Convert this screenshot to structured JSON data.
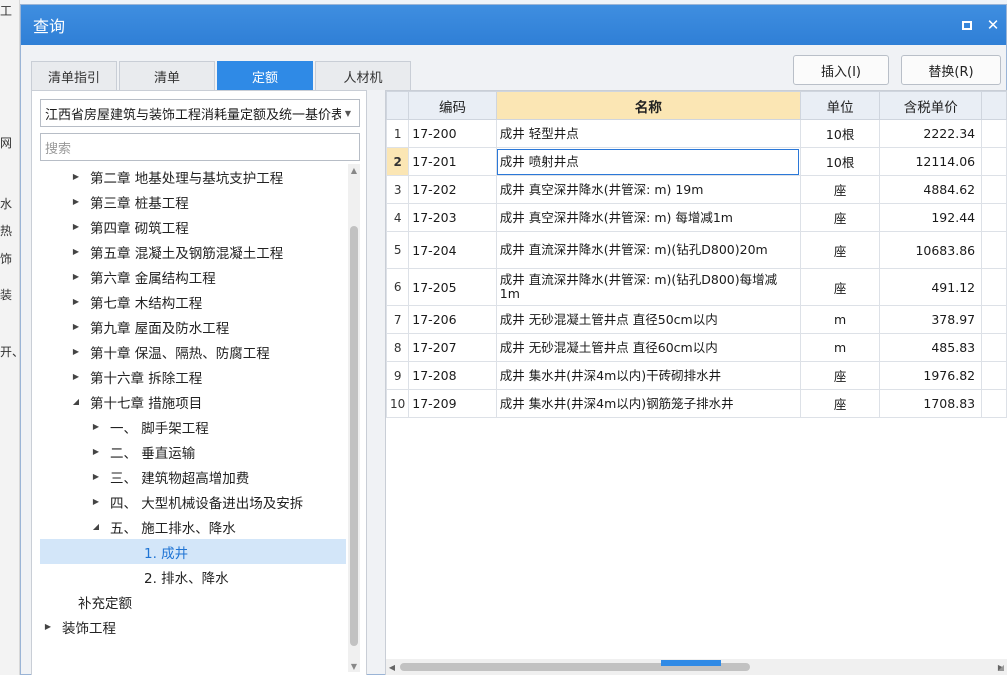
{
  "background": {
    "frags": [
      "工",
      "网",
      "水",
      "热",
      "饰",
      "装",
      "开、"
    ]
  },
  "dialog": {
    "title": "查询",
    "maximize_label": "",
    "close_label": "✕"
  },
  "tabs": [
    "清单指引",
    "清单",
    "定额",
    "人材机"
  ],
  "active_tab": 2,
  "buttons": {
    "insert": "插入(I)",
    "replace": "替换(R)"
  },
  "left_panel": {
    "library": "江西省房屋建筑与装饰工程消耗量定额及统一基价表",
    "search_placeholder": "搜索",
    "tree": [
      {
        "label": "第二章 地基处理与基坑支护工程",
        "level": 1,
        "expander": "collapsed"
      },
      {
        "label": "第三章 桩基工程",
        "level": 1,
        "expander": "collapsed"
      },
      {
        "label": "第四章 砌筑工程",
        "level": 1,
        "expander": "collapsed"
      },
      {
        "label": "第五章 混凝土及钢筋混凝土工程",
        "level": 1,
        "expander": "collapsed"
      },
      {
        "label": "第六章 金属结构工程",
        "level": 1,
        "expander": "collapsed"
      },
      {
        "label": "第七章 木结构工程",
        "level": 1,
        "expander": "collapsed"
      },
      {
        "label": "第九章 屋面及防水工程",
        "level": 1,
        "expander": "collapsed"
      },
      {
        "label": "第十章 保温、隔热、防腐工程",
        "level": 1,
        "expander": "collapsed"
      },
      {
        "label": "第十六章 拆除工程",
        "level": 1,
        "expander": "collapsed"
      },
      {
        "label": "第十七章 措施项目",
        "level": 1,
        "expander": "expanded"
      },
      {
        "label": "一、 脚手架工程",
        "level": 2,
        "expander": "collapsed"
      },
      {
        "label": "二、 垂直运输",
        "level": 2,
        "expander": "collapsed"
      },
      {
        "label": "三、 建筑物超高增加费",
        "level": 2,
        "expander": "collapsed"
      },
      {
        "label": "四、 大型机械设备进出场及安拆",
        "level": 2,
        "expander": "collapsed"
      },
      {
        "label": "五、 施工排水、降水",
        "level": 2,
        "expander": "expanded"
      },
      {
        "label": "1. 成井",
        "level": 3,
        "expander": "none",
        "selected": true
      },
      {
        "label": "2. 排水、降水",
        "level": 3,
        "expander": "none"
      },
      {
        "label": "补充定额",
        "level": 1,
        "expander": "none"
      },
      {
        "label": "装饰工程",
        "level": 0,
        "expander": "collapsed"
      }
    ]
  },
  "table": {
    "columns": [
      "编码",
      "名称",
      "单位",
      "含税单价"
    ],
    "rows": [
      {
        "no": "1",
        "code": "17-200",
        "name": "成井 轻型井点",
        "unit": "10根",
        "price": "2222.34"
      },
      {
        "no": "2",
        "code": "17-201",
        "name": "成井 喷射井点",
        "unit": "10根",
        "price": "12114.06"
      },
      {
        "no": "3",
        "code": "17-202",
        "name": "成井 真空深井降水(井管深: m) 19m",
        "unit": "座",
        "price": "4884.62"
      },
      {
        "no": "4",
        "code": "17-203",
        "name": "成井 真空深井降水(井管深: m) 每增减1m",
        "unit": "座",
        "price": "192.44"
      },
      {
        "no": "5",
        "code": "17-204",
        "name": "成井 直流深井降水(井管深: m)(钻孔D800)20m",
        "unit": "座",
        "price": "10683.86"
      },
      {
        "no": "6",
        "code": "17-205",
        "name": "成井 直流深井降水(井管深: m)(钻孔D800)每增减1m",
        "unit": "座",
        "price": "491.12"
      },
      {
        "no": "7",
        "code": "17-206",
        "name": "成井 无砂混凝土管井点 直径50cm以内",
        "unit": "m",
        "price": "378.97"
      },
      {
        "no": "8",
        "code": "17-207",
        "name": "成井 无砂混凝土管井点 直径60cm以内",
        "unit": "m",
        "price": "485.83"
      },
      {
        "no": "9",
        "code": "17-208",
        "name": "成井 集水井(井深4m以内)干砖砌排水井",
        "unit": "座",
        "price": "1976.82"
      },
      {
        "no": "10",
        "code": "17-209",
        "name": "成井 集水井(井深4m以内)钢筋笼子排水井",
        "unit": "座",
        "price": "1708.83"
      }
    ],
    "current_row": 1
  },
  "colors": {
    "accent": "#2f8ae6",
    "header_highlight": "#fbe6b4",
    "selection": "#d3e6f9"
  }
}
